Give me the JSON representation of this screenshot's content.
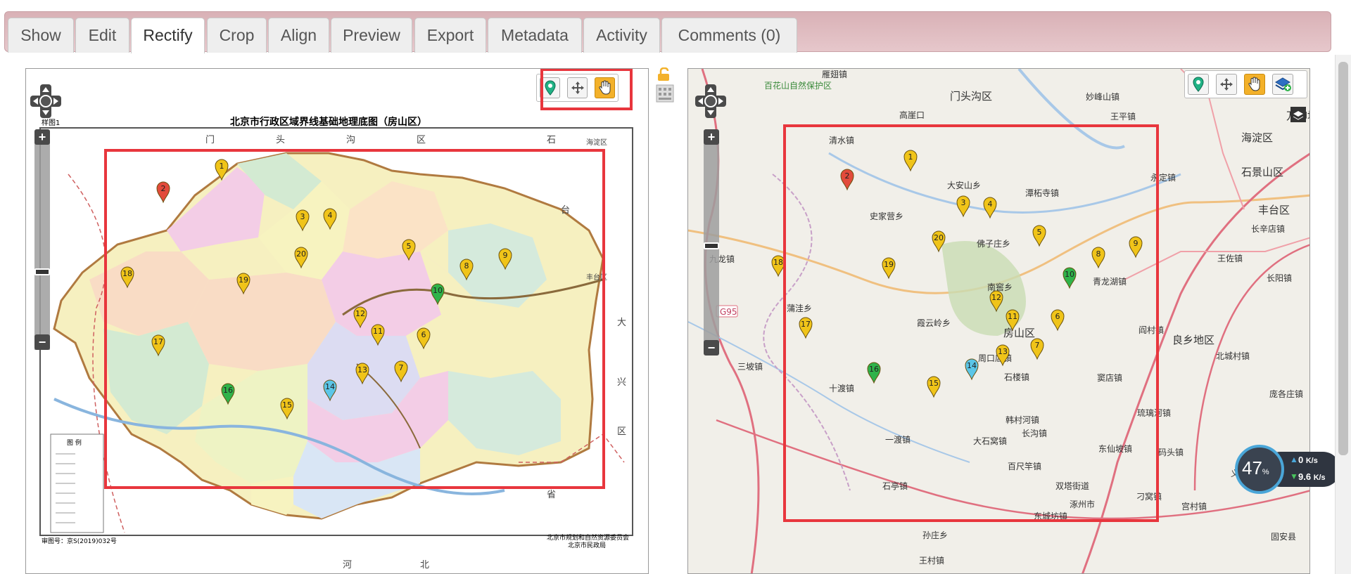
{
  "tabs": [
    {
      "label": "Show",
      "active": false
    },
    {
      "label": "Edit",
      "active": false
    },
    {
      "label": "Rectify",
      "active": true
    },
    {
      "label": "Crop",
      "active": false
    },
    {
      "label": "Align",
      "active": false
    },
    {
      "label": "Preview",
      "active": false
    },
    {
      "label": "Export",
      "active": false
    },
    {
      "label": "Metadata",
      "active": false
    },
    {
      "label": "Activity",
      "active": false
    },
    {
      "label": "Comments (0)",
      "active": false
    }
  ],
  "left_map": {
    "title": "北京市行政区域界线基础地理底图（房山区）",
    "corner_label": "样图1",
    "approval": "审图号：京S(2019)032号",
    "publisher_1": "北京市规划和自然资源委员会",
    "publisher_2": "北京市民政局",
    "edge_labels": [
      "门",
      "头",
      "沟",
      "区",
      "河",
      "北",
      "省",
      "大",
      "兴",
      "区",
      "石",
      "台",
      "海淀区",
      "丰台区"
    ],
    "legend_title": "图 例",
    "toolbar_icons": [
      "add-point-icon",
      "move-icon",
      "pan-hand-icon"
    ],
    "active_tool": "pan-hand-icon"
  },
  "right_map": {
    "place_labels": [
      "百花山自然保护区",
      "雁翅镇",
      "门头沟区",
      "妙峰山镇",
      "王平镇",
      "高崖口",
      "清水镇",
      "史家营乡",
      "大安山乡",
      "潭柘寺镇",
      "永定镇",
      "石景山区",
      "海淀区",
      "万柳地区",
      "丰台区",
      "长辛店镇",
      "佛子庄乡",
      "南窖乡",
      "青龙湖镇",
      "王佐镇",
      "九龙镇",
      "蒲洼乡",
      "霞云岭乡",
      "房山区",
      "阎村镇",
      "长阳镇",
      "良乡地区",
      "北城村镇",
      "周口店镇",
      "石楼镇",
      "窦店镇",
      "庞各庄镇",
      "三坡镇",
      "十渡镇",
      "琉璃河镇",
      "韩村河镇",
      "一渡镇",
      "长沟镇",
      "大石窝镇",
      "东仙坡镇",
      "码头镇",
      "百尺竿镇",
      "义和庄镇",
      "石亭镇",
      "双塔街道",
      "涿州市",
      "刁窝镇",
      "东城坊镇",
      "孙庄乡",
      "宫村镇",
      "王村镇",
      "固安县",
      "百尺竿镇"
    ],
    "road_label": "G95",
    "toolbar_icons": [
      "add-point-icon",
      "move-icon",
      "pan-hand-icon",
      "layers-icon"
    ],
    "active_tool": "pan-hand-icon"
  },
  "control_points": [
    {
      "n": "1",
      "color": "#f0c419"
    },
    {
      "n": "2",
      "color": "#e24b3b"
    },
    {
      "n": "3",
      "color": "#f0c419"
    },
    {
      "n": "4",
      "color": "#f0c419"
    },
    {
      "n": "5",
      "color": "#f0c419"
    },
    {
      "n": "6",
      "color": "#f0c419"
    },
    {
      "n": "7",
      "color": "#f0c419"
    },
    {
      "n": "8",
      "color": "#f0c419"
    },
    {
      "n": "9",
      "color": "#f0c419"
    },
    {
      "n": "10",
      "color": "#2fb34a"
    },
    {
      "n": "11",
      "color": "#f0c419"
    },
    {
      "n": "12",
      "color": "#f0c419"
    },
    {
      "n": "13",
      "color": "#f0c419"
    },
    {
      "n": "14",
      "color": "#5bc6e8"
    },
    {
      "n": "15",
      "color": "#f0c419"
    },
    {
      "n": "16",
      "color": "#2fb34a"
    },
    {
      "n": "17",
      "color": "#f0c419"
    },
    {
      "n": "18",
      "color": "#f0c419"
    },
    {
      "n": "19",
      "color": "#f0c419"
    },
    {
      "n": "20",
      "color": "#f0c419"
    }
  ],
  "network_stats": {
    "percent": "47",
    "pct_sign": "%",
    "upload": "0",
    "upload_unit": "K/s",
    "download": "9.6",
    "download_unit": "K/s"
  },
  "colors": {
    "highlight": "#e8363d",
    "tool_active": "#f3b12a",
    "tab_bar": "#d9b1b6"
  }
}
